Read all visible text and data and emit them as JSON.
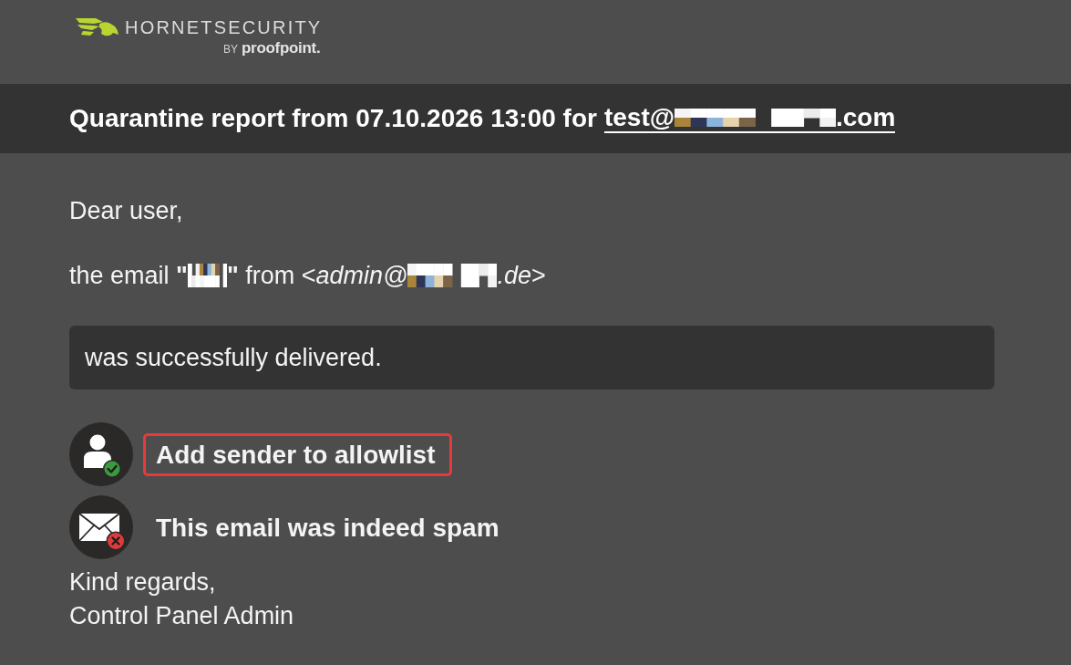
{
  "logo": {
    "wordmark": "HORNETSECURITY",
    "byline": "BY",
    "partner": "proofpoint."
  },
  "header": {
    "title": "Quarantine report from 07.10.2026 13:00 for",
    "recipient": [
      {
        "kind": "text",
        "text": "test@"
      },
      {
        "kind": "redaction"
      },
      {
        "kind": "text",
        "text": ".com"
      }
    ]
  },
  "greeting": "Dear user,",
  "message": [
    {
      "kind": "text",
      "text": "the email **\"**"
    },
    {
      "kind": "redaction"
    },
    {
      "kind": "text",
      "text": "**\"** from <*admin@*"
    },
    {
      "kind": "redaction"
    },
    {
      "kind": "text",
      "text": "*.de*>"
    }
  ],
  "status": "was successfully delivered.",
  "actions": [
    {
      "kind": "allowlist",
      "label": "Add sender to allowlist",
      "highlighted": true
    },
    {
      "kind": "spam",
      "label": "This email was indeed spam",
      "highlighted": false
    }
  ],
  "closing": [
    "Kind regards,",
    "Control Panel Admin"
  ]
}
